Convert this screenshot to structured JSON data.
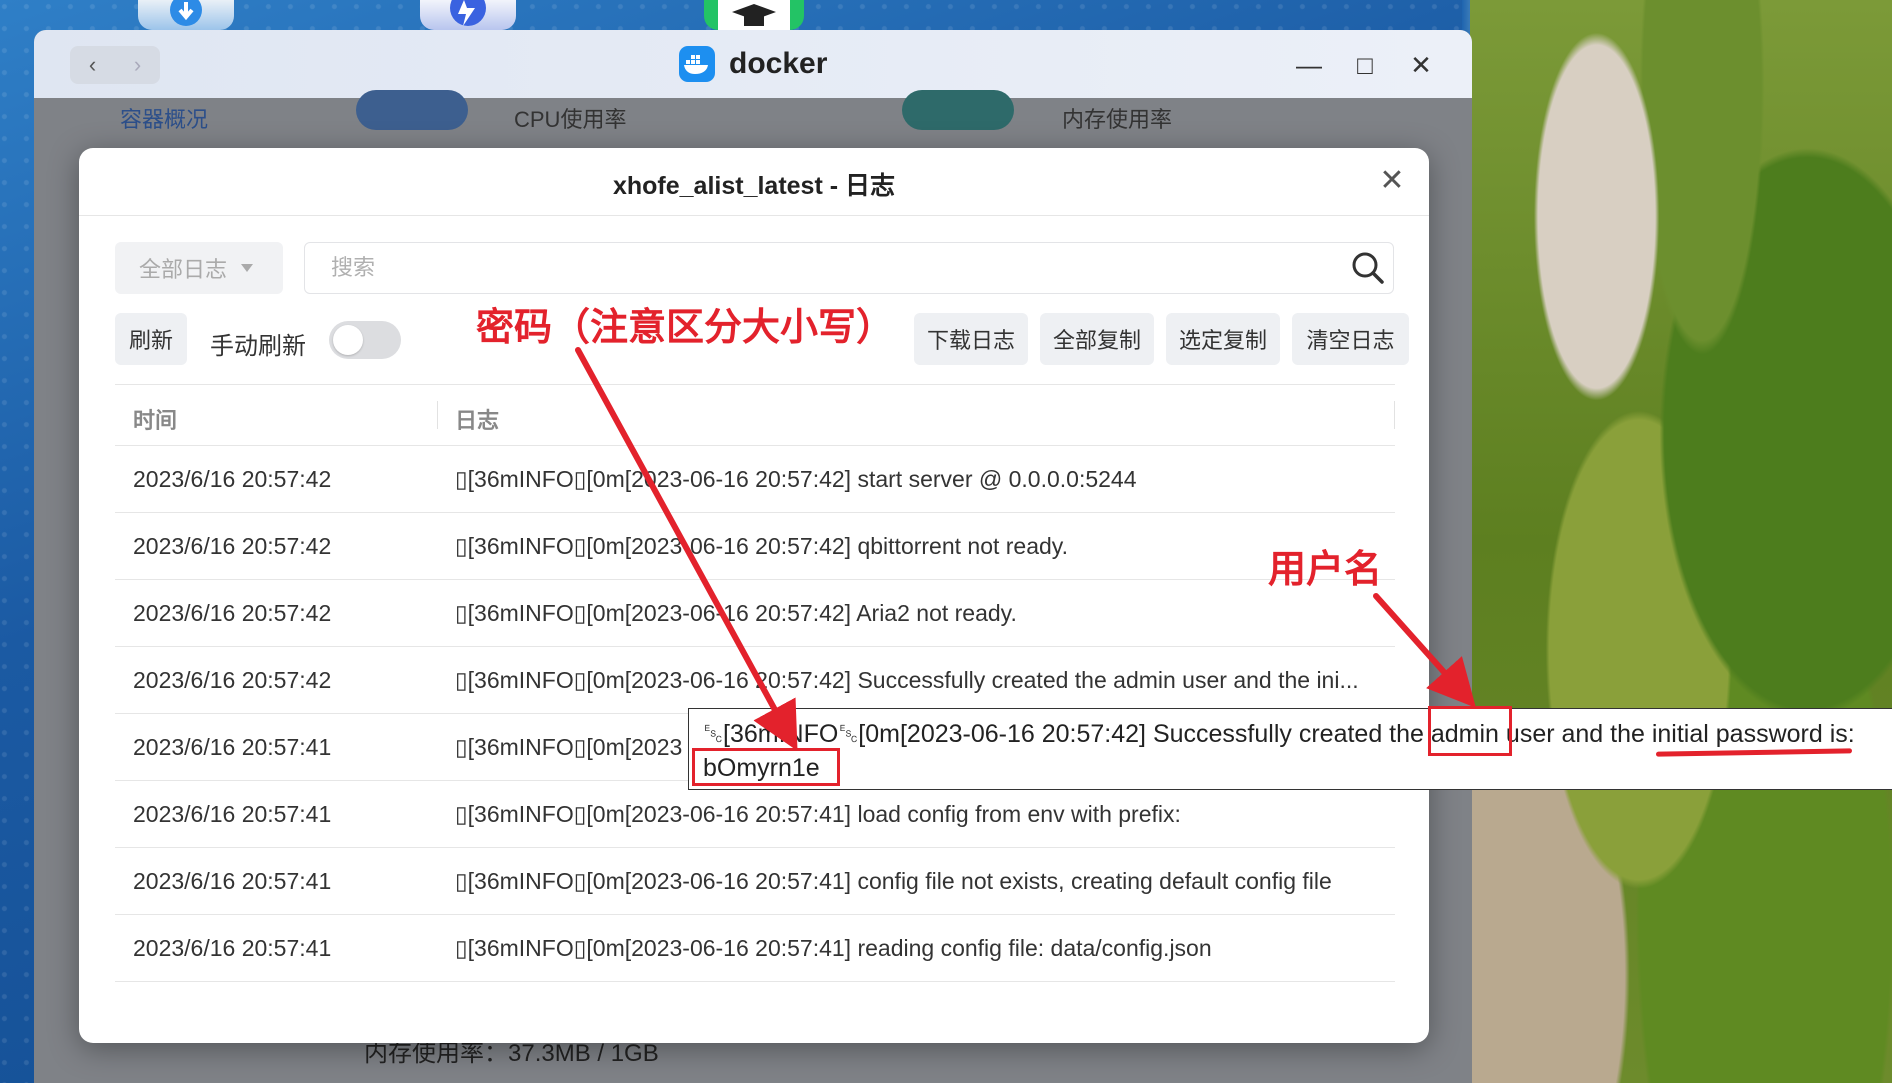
{
  "window": {
    "app_title": "docker",
    "nav_back": "‹",
    "nav_forward": "›",
    "minimize": "—",
    "maximize": "□",
    "close": "✕"
  },
  "background": {
    "tab_overview": "容器概况",
    "tab_cpu": "CPU使用率",
    "tab_memory": "内存使用率",
    "memory_usage_text": "内存使用率：37.3MB / 1GB"
  },
  "dialog": {
    "title": "xhofe_alist_latest - 日志",
    "close": "✕",
    "filter_label": "全部日志",
    "search_placeholder": "搜索",
    "refresh": "刷新",
    "manual_refresh_label": "手动刷新",
    "buttons": [
      "下载日志",
      "全部复制",
      "选定复制",
      "清空日志"
    ],
    "columns": {
      "time": "时间",
      "log": "日志"
    },
    "rows": [
      {
        "time": "2023/6/16 20:57:42",
        "log": "▯[36mINFO▯[0m[2023-06-16 20:57:42] start server @ 0.0.0.0:5244"
      },
      {
        "time": "2023/6/16 20:57:42",
        "log": "▯[36mINFO▯[0m[2023-06-16 20:57:42] qbittorrent not ready."
      },
      {
        "time": "2023/6/16 20:57:42",
        "log": "▯[36mINFO▯[0m[2023-06-16 20:57:42] Aria2 not ready."
      },
      {
        "time": "2023/6/16 20:57:42",
        "log": "▯[36mINFO▯[0m[2023-06-16 20:57:42] Successfully created the admin user and the ini..."
      },
      {
        "time": "2023/6/16 20:57:41",
        "log": "▯[36mINFO▯[0m[2023"
      },
      {
        "time": "2023/6/16 20:57:41",
        "log": "▯[36mINFO▯[0m[2023-06-16 20:57:41] load config from env with prefix:"
      },
      {
        "time": "2023/6/16 20:57:41",
        "log": "▯[36mINFO▯[0m[2023-06-16 20:57:41] config file not exists, creating default config file"
      },
      {
        "time": "2023/6/16 20:57:41",
        "log": "▯[36mINFO▯[0m[2023-06-16 20:57:41] reading config file: data/config.json"
      }
    ]
  },
  "tooltip": {
    "line1_prefix": "␛[36mINFO␛[0m[2023-06-16 20:57:42] Successfully created the ",
    "line1_admin": "admin",
    "line1_suffix": " user and the initial password is:",
    "password": "bOmyrn1e"
  },
  "annotations": {
    "password_note": "密码（注意区分大小写）",
    "username_note": "用户名",
    "color": "#e3222c"
  }
}
